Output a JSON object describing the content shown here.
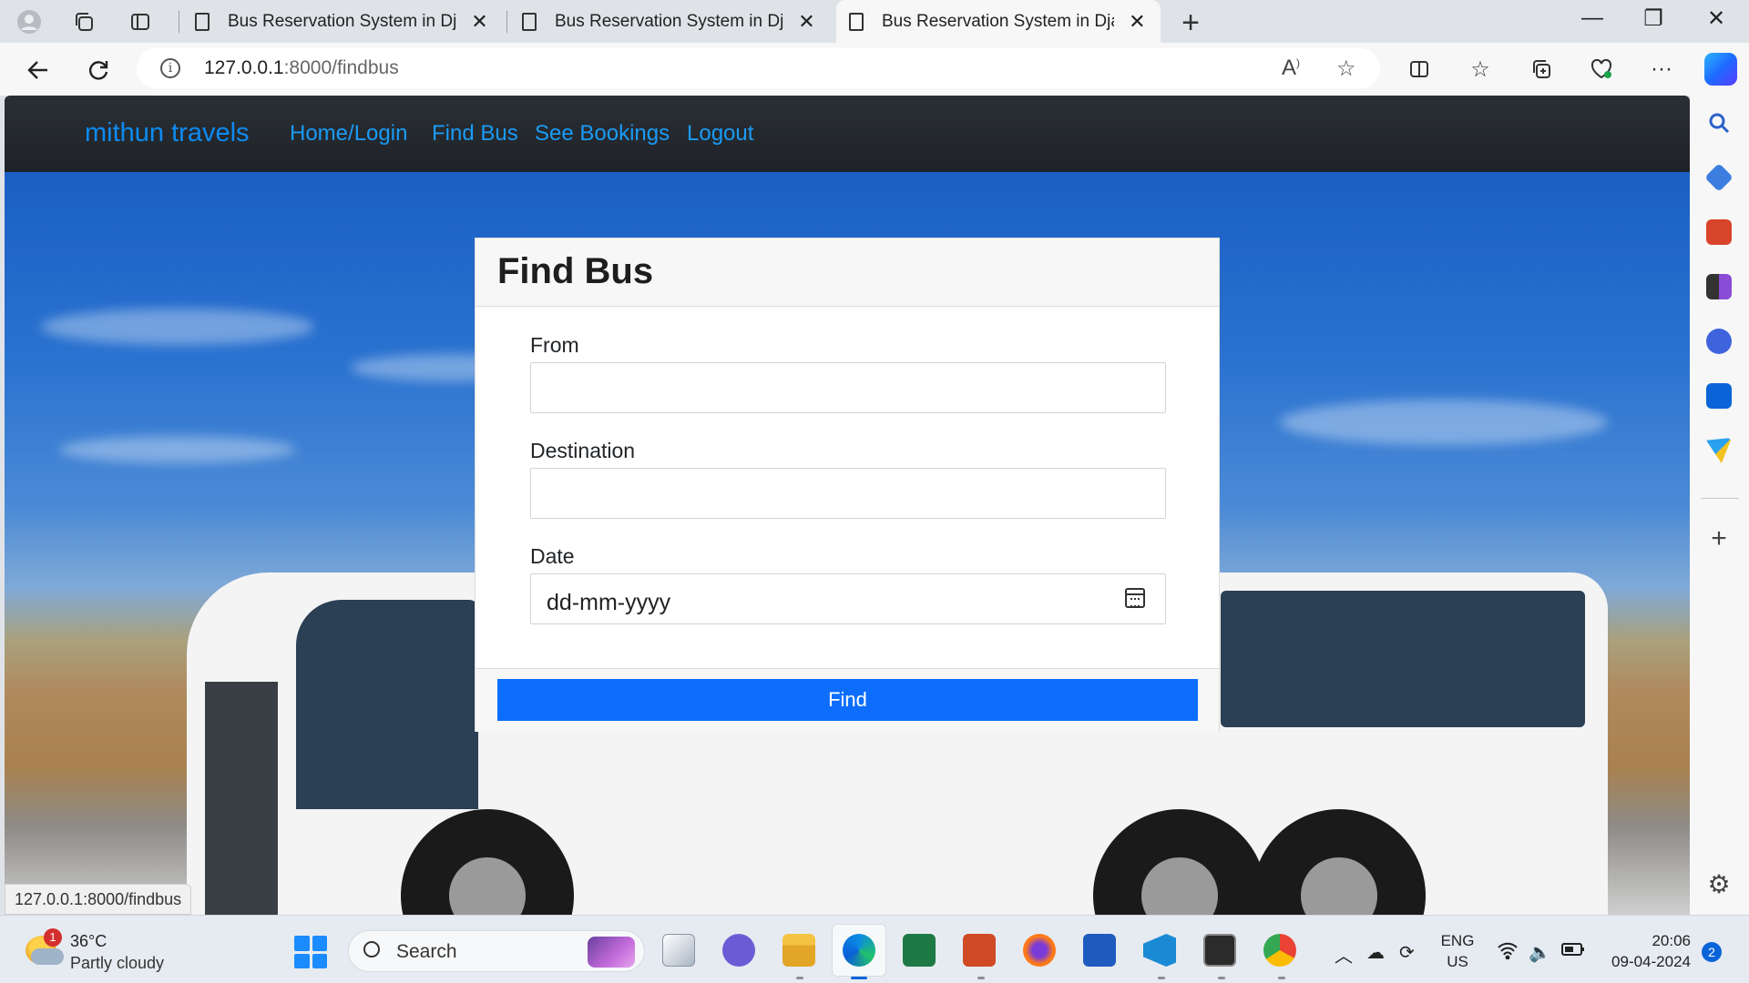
{
  "browser": {
    "tabs": [
      {
        "title": "Bus Reservation System in Django",
        "active": false
      },
      {
        "title": "Bus Reservation System in Django",
        "active": false
      },
      {
        "title": "Bus Reservation System in Django",
        "active": true
      }
    ],
    "address": {
      "host": "127.0.0.1",
      "rest": ":8000/findbus"
    },
    "status_url": "127.0.0.1:8000/findbus"
  },
  "site": {
    "brand": "mithun travels",
    "nav": [
      "Home/Login",
      "Find Bus",
      "See Bookings",
      "Logout"
    ]
  },
  "form": {
    "title": "Find Bus",
    "from_label": "From",
    "from_value": "",
    "destination_label": "Destination",
    "destination_value": "",
    "date_label": "Date",
    "date_placeholder": "dd-mm-yyyy",
    "submit_label": "Find",
    "submit_color": "#0d6efd"
  },
  "taskbar": {
    "weather_badge": "1",
    "temperature": "36°C",
    "weather": "Partly cloudy",
    "search_label": "Search",
    "lang_top": "ENG",
    "lang_bottom": "US",
    "time": "20:06",
    "date": "09-04-2024",
    "notification_count": "2"
  }
}
